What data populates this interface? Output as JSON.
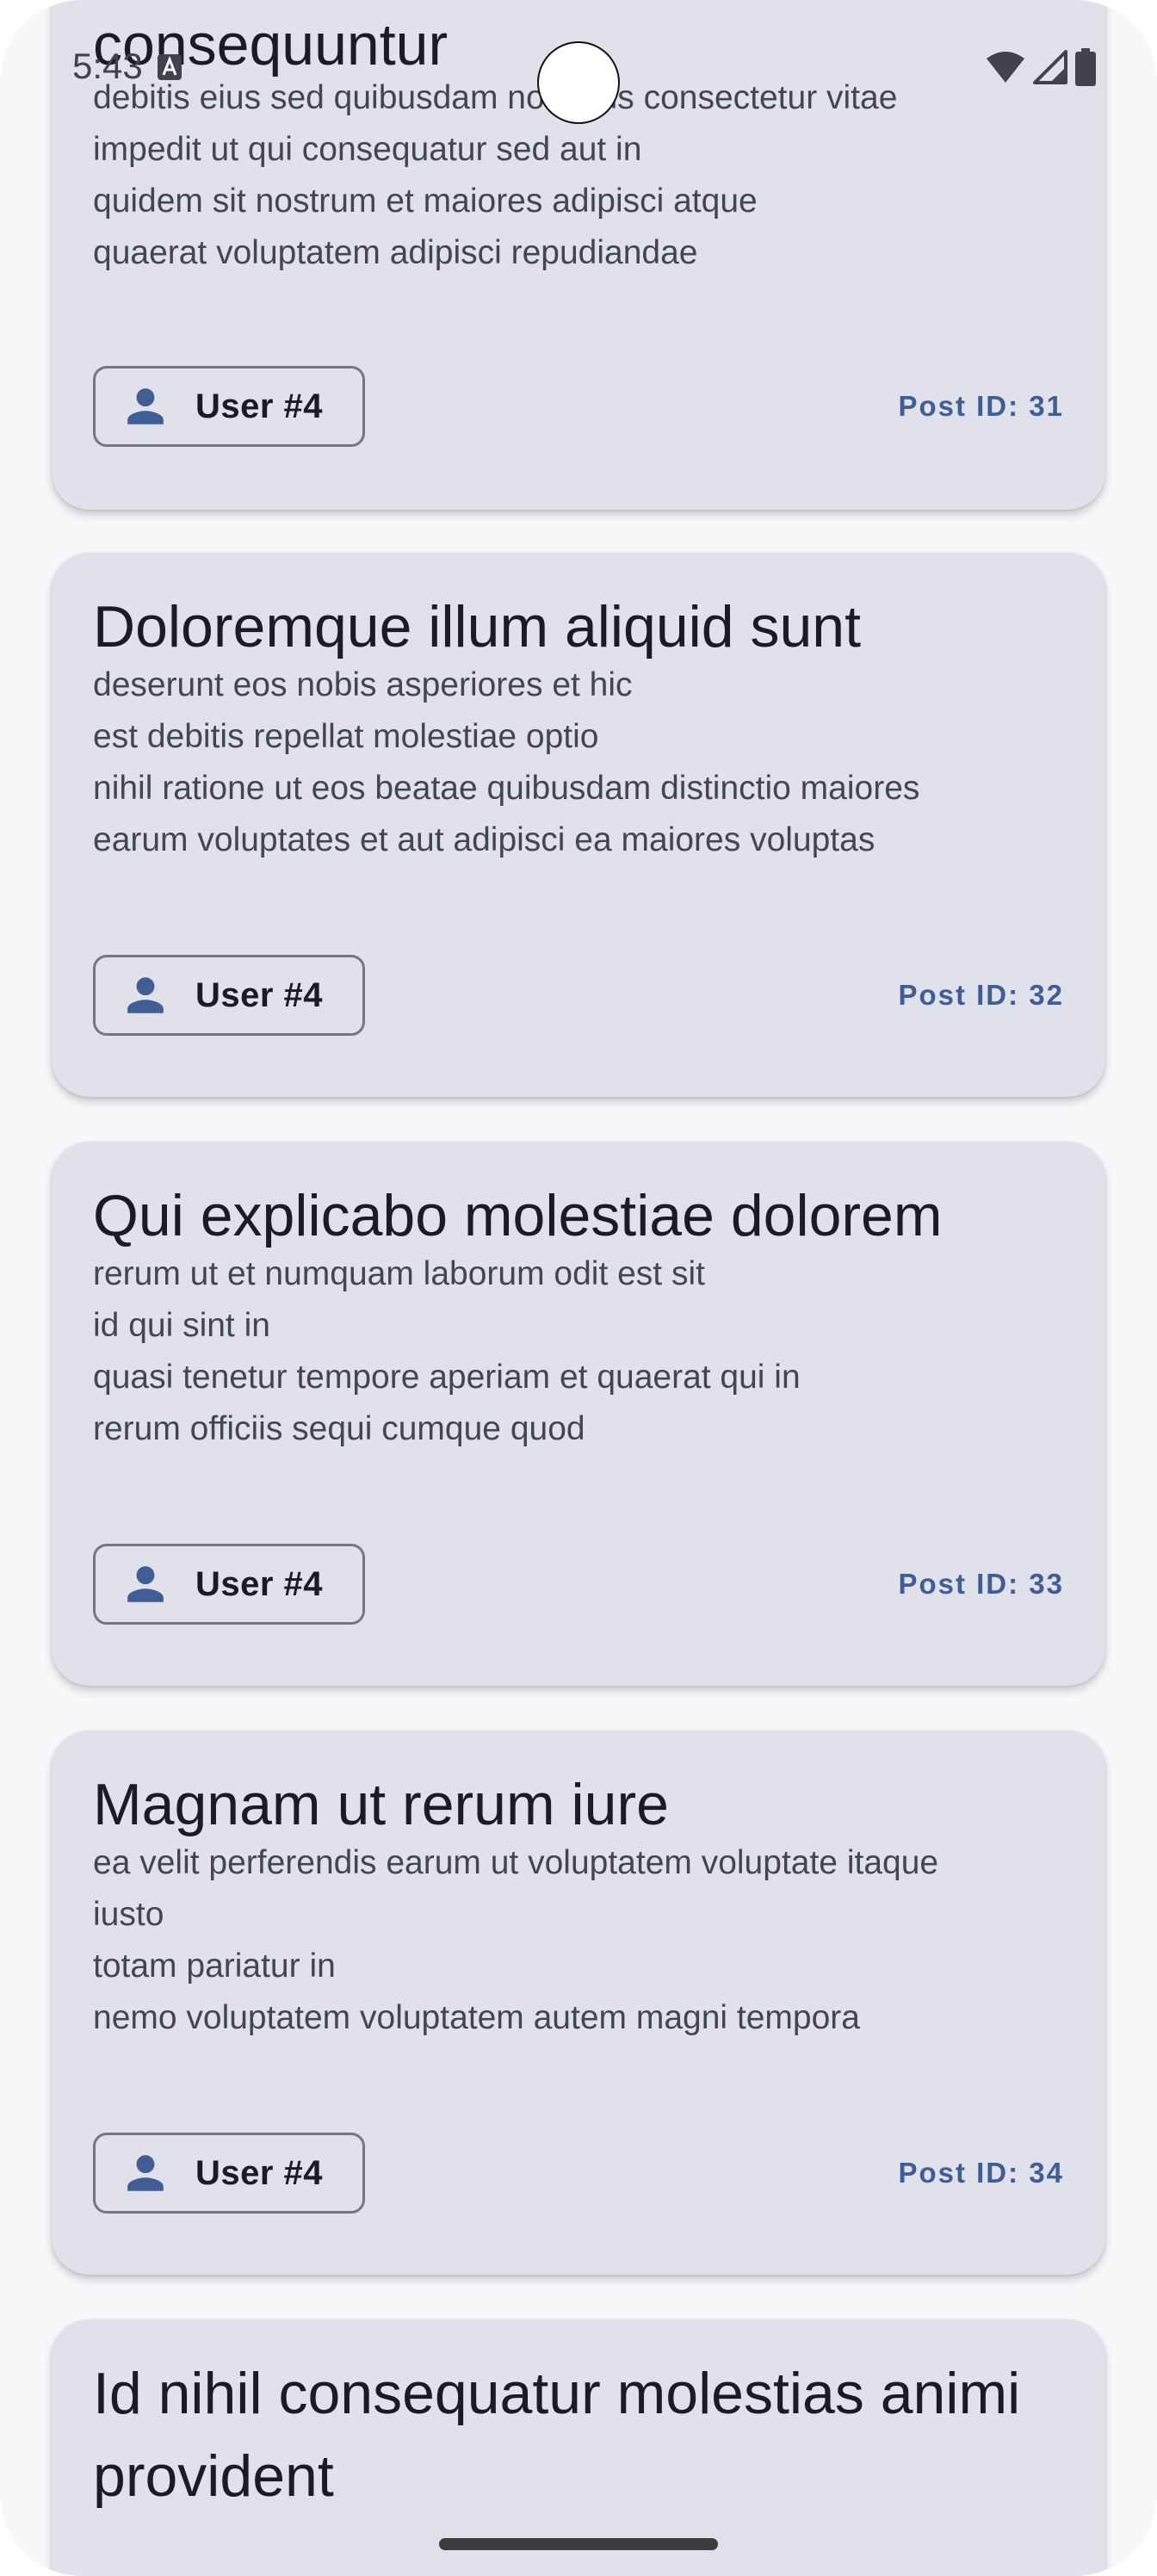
{
  "status_bar": {
    "time": "5:43",
    "icons": [
      "notification-a-icon",
      "wifi-icon",
      "cell-signal-icon",
      "battery-icon"
    ]
  },
  "colors": {
    "card_background": "#e1e1eb",
    "title_text": "#1b1c21",
    "body_text": "#44464f",
    "post_id_text": "#405d95",
    "chip_border": "#757780",
    "user_icon": "#405d95"
  },
  "posts": [
    {
      "title": "consequuntur",
      "body": [
        "debitis eius sed quibusdam non quis consectetur vitae",
        "impedit ut qui consequatur sed aut in",
        "quidem sit nostrum et maiores adipisci atque",
        "quaerat voluptatem adipisci repudiandae"
      ],
      "user": "User #4",
      "post_id": "Post ID: 31",
      "user_icon": "person-icon"
    },
    {
      "title": "Doloremque illum aliquid sunt",
      "body": [
        "deserunt eos nobis asperiores et hic",
        "est debitis repellat molestiae optio",
        "nihil ratione ut eos beatae quibusdam distinctio maiores",
        "earum voluptates et aut adipisci ea maiores voluptas"
      ],
      "user": "User #4",
      "post_id": "Post ID: 32",
      "user_icon": "person-icon"
    },
    {
      "title": "Qui explicabo molestiae dolorem",
      "body": [
        "rerum ut et numquam laborum odit est sit",
        "id qui sint in",
        "quasi tenetur tempore aperiam et quaerat qui in",
        "rerum officiis sequi cumque quod"
      ],
      "user": "User #4",
      "post_id": "Post ID: 33",
      "user_icon": "person-icon"
    },
    {
      "title": "Magnam ut rerum iure",
      "body": [
        "ea velit perferendis earum ut voluptatem voluptate itaque",
        "iusto",
        "totam pariatur in",
        "nemo voluptatem voluptatem autem magni tempora"
      ],
      "user": "User #4",
      "post_id": "Post ID: 34",
      "user_icon": "person-icon"
    },
    {
      "title": "Id nihil consequatur molestias animi provident"
    }
  ]
}
